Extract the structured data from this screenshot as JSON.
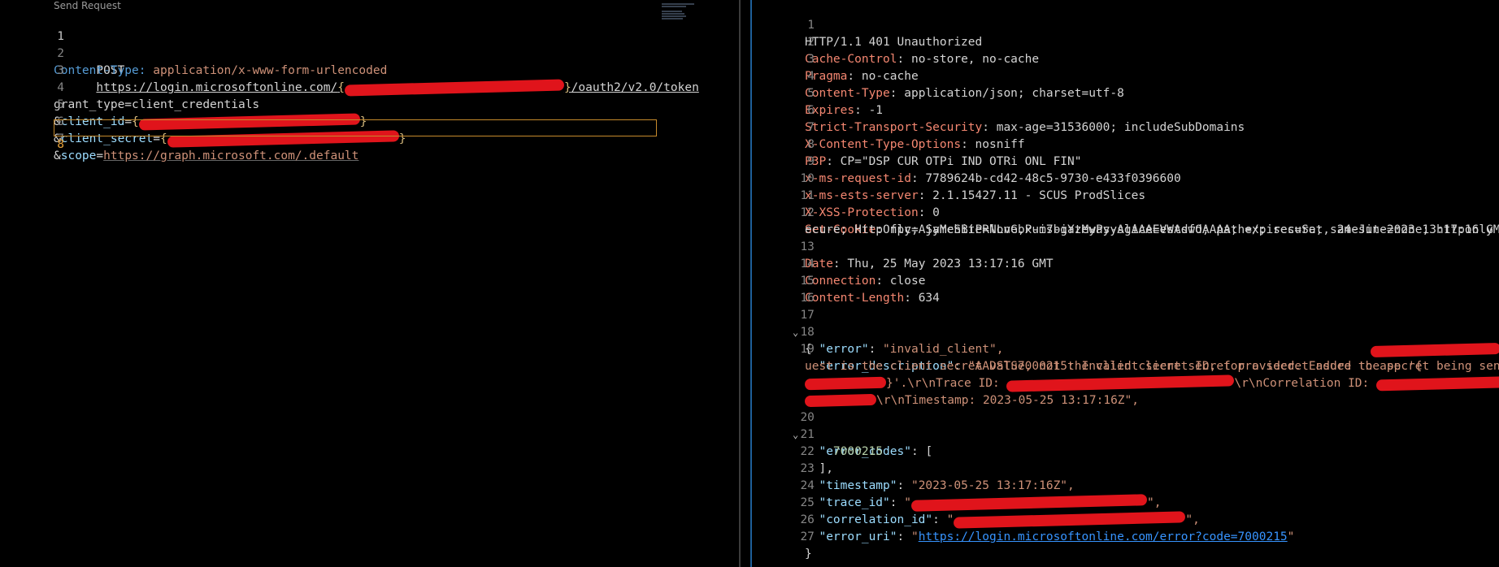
{
  "editor": {
    "codelens": "Send Request",
    "lines": [
      {
        "n": "1",
        "method": "POST",
        "url_prefix": "https://login.microsoftonline.com/",
        "brace_open": "{",
        "brace_close": "}",
        "url_suffix": "/oauth2/v2.0/token"
      },
      {
        "n": "2",
        "header_name": "Content-Type:",
        "header_value": "application/x-www-form-urlencoded"
      },
      {
        "n": "3"
      },
      {
        "n": "4",
        "text": "grant_type=client_credentials"
      },
      {
        "n": "5",
        "amp": "&",
        "key": "client_id",
        "eq": "=",
        "brace_open": "{",
        "brace_close": "}"
      },
      {
        "n": "6",
        "amp": "&",
        "key": "client_secret",
        "eq": "=",
        "brace_open": "{",
        "brace_close": "}"
      },
      {
        "n": "7",
        "amp": "&",
        "key": "scope",
        "eq": "=",
        "value": "https://graph.microsoft.com/.default"
      },
      {
        "n": "8"
      }
    ]
  },
  "response": {
    "lines": [
      {
        "n": "1",
        "status": "HTTP/1.1 401 Unauthorized"
      },
      {
        "n": "2",
        "name": "Cache-Control",
        "value": "no-store, no-cache"
      },
      {
        "n": "3",
        "name": "Pragma",
        "value": "no-cache"
      },
      {
        "n": "4",
        "name": "Content-Type",
        "value": "application/json; charset=utf-8"
      },
      {
        "n": "5",
        "name": "Expires",
        "value": "-1"
      },
      {
        "n": "6",
        "name": "Strict-Transport-Security",
        "value": "max-age=31536000; includeSubDomains"
      },
      {
        "n": "7",
        "name": "X-Content-Type-Options",
        "value": "nosniff"
      },
      {
        "n": "8",
        "name": "P3P",
        "value": "CP=\"DSP CUR OTPi IND OTRi ONL FIN\""
      },
      {
        "n": "9",
        "name": "x-ms-request-id",
        "value": "7789624b-cd42-48c5-9730-e433f0396600"
      },
      {
        "n": "10",
        "name": "x-ms-ests-server",
        "value": "2.1.15427.11 - SCUS ProdSlices"
      },
      {
        "n": "11",
        "name": "X-XSS-Protection",
        "value": "0"
      },
      {
        "n": "12",
        "name": "Set-Cookie",
        "value": "fpc=AjyMchBiPRlLvGbPui7biYzMyPsyAgAAAEVWAdwOAAAA; expires=Sat, 24-Jun-2023 13:17:16 GMT; path=/; s",
        "value2": "ecure; HttpOnly; SameSite=None,x-ms-gateway-slice=estsfd; path=/; secure; samesite=none; httponly"
      },
      {
        "n": "13",
        "name": "Date",
        "value": "Thu, 25 May 2023 13:17:16 GMT"
      },
      {
        "n": "14",
        "name": "Connection",
        "value": "close"
      },
      {
        "n": "15",
        "name": "Content-Length",
        "value": "634"
      },
      {
        "n": "16"
      },
      {
        "n": "17",
        "text": "{"
      },
      {
        "n": "18",
        "key": "\"error\"",
        "val": "\"invalid_client\","
      },
      {
        "n": "19",
        "key": "\"error_description\"",
        "val": "\"AADSTS7000215: Invalid client secret provided. Ensure the secret being sent in the req",
        "val2": "uest is the client secret value, not the client secret ID, for a secret added to app '{",
        "val3a": "}'.\\r\\nTrace ID: ",
        "val3b": "\\r\\nCorrelation ID: ",
        "val4": "\\r\\nTimestamp: 2023-05-25 13:17:16Z\","
      },
      {
        "n": "20",
        "key": "\"error_codes\"",
        "val": "["
      },
      {
        "n": "21",
        "num": "7000215"
      },
      {
        "n": "22",
        "text": "],"
      },
      {
        "n": "23",
        "key": "\"timestamp\"",
        "val": "\"2023-05-25 13:17:16Z\","
      },
      {
        "n": "24",
        "key": "\"trace_id\"",
        "q1": "\"",
        "q2": "\","
      },
      {
        "n": "25",
        "key": "\"correlation_id\"",
        "q1": "\"",
        "q2": "\","
      },
      {
        "n": "26",
        "key": "\"error_uri\"",
        "q1": "\"",
        "link": "https://login.microsoftonline.com/error?code=7000215",
        "q2": "\""
      },
      {
        "n": "27",
        "text": "}"
      }
    ]
  },
  "colors": {
    "background": "#000000",
    "redaction": "#e0141b",
    "accent_cursor": "#c68a2c"
  }
}
